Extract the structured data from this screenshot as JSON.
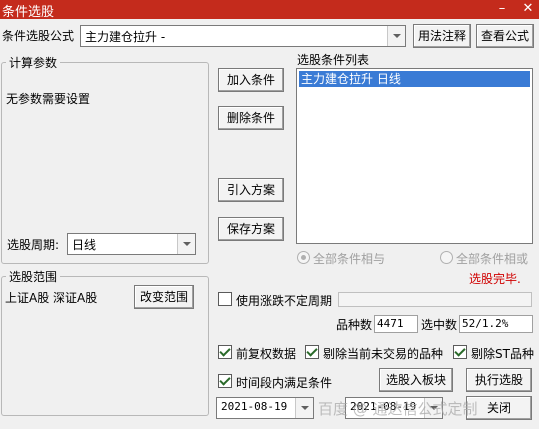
{
  "window": {
    "title": "条件选股"
  },
  "top": {
    "formula_label": "条件选股公式",
    "formula_value": "主力建仓拉升 -",
    "usage_button": "用法注释",
    "view_formula_button": "查看公式"
  },
  "params": {
    "legend": "计算参数",
    "none_text": "无参数需要设置",
    "period_label": "选股周期:",
    "period_value": "日线"
  },
  "actions": {
    "add": "加入条件",
    "delete": "删除条件",
    "import": "引入方案",
    "save": "保存方案"
  },
  "conditions": {
    "title": "选股条件列表",
    "items": [
      "主力建仓拉升  日线"
    ],
    "and_label": "全部条件相与",
    "or_label": "全部条件相或",
    "status": "选股完毕."
  },
  "range": {
    "legend": "选股范围",
    "text": "上证A股 深证A股",
    "change_button": "改变范围"
  },
  "options": {
    "indefinite_period": "使用涨跌不定周期",
    "count_label": "品种数",
    "count_value": "4471",
    "selected_label": "选中数",
    "selected_value": "52/1.2%",
    "pre_adjust": "前复权数据",
    "exclude_untraded": "剔除当前未交易的品种",
    "exclude_st": "剔除ST品种",
    "time_range": "时间段内满足条件",
    "to_block_button": "选股入板块",
    "run_button": "执行选股",
    "start_date": "2021-08-19",
    "end_date": "2021-08-19",
    "close_button": "关闭"
  },
  "watermark": "百度 @ 通达信公式定制",
  "colors": {
    "titlebar": "#c42b1c",
    "selection": "#3a7bd5",
    "status": "#d00000"
  }
}
